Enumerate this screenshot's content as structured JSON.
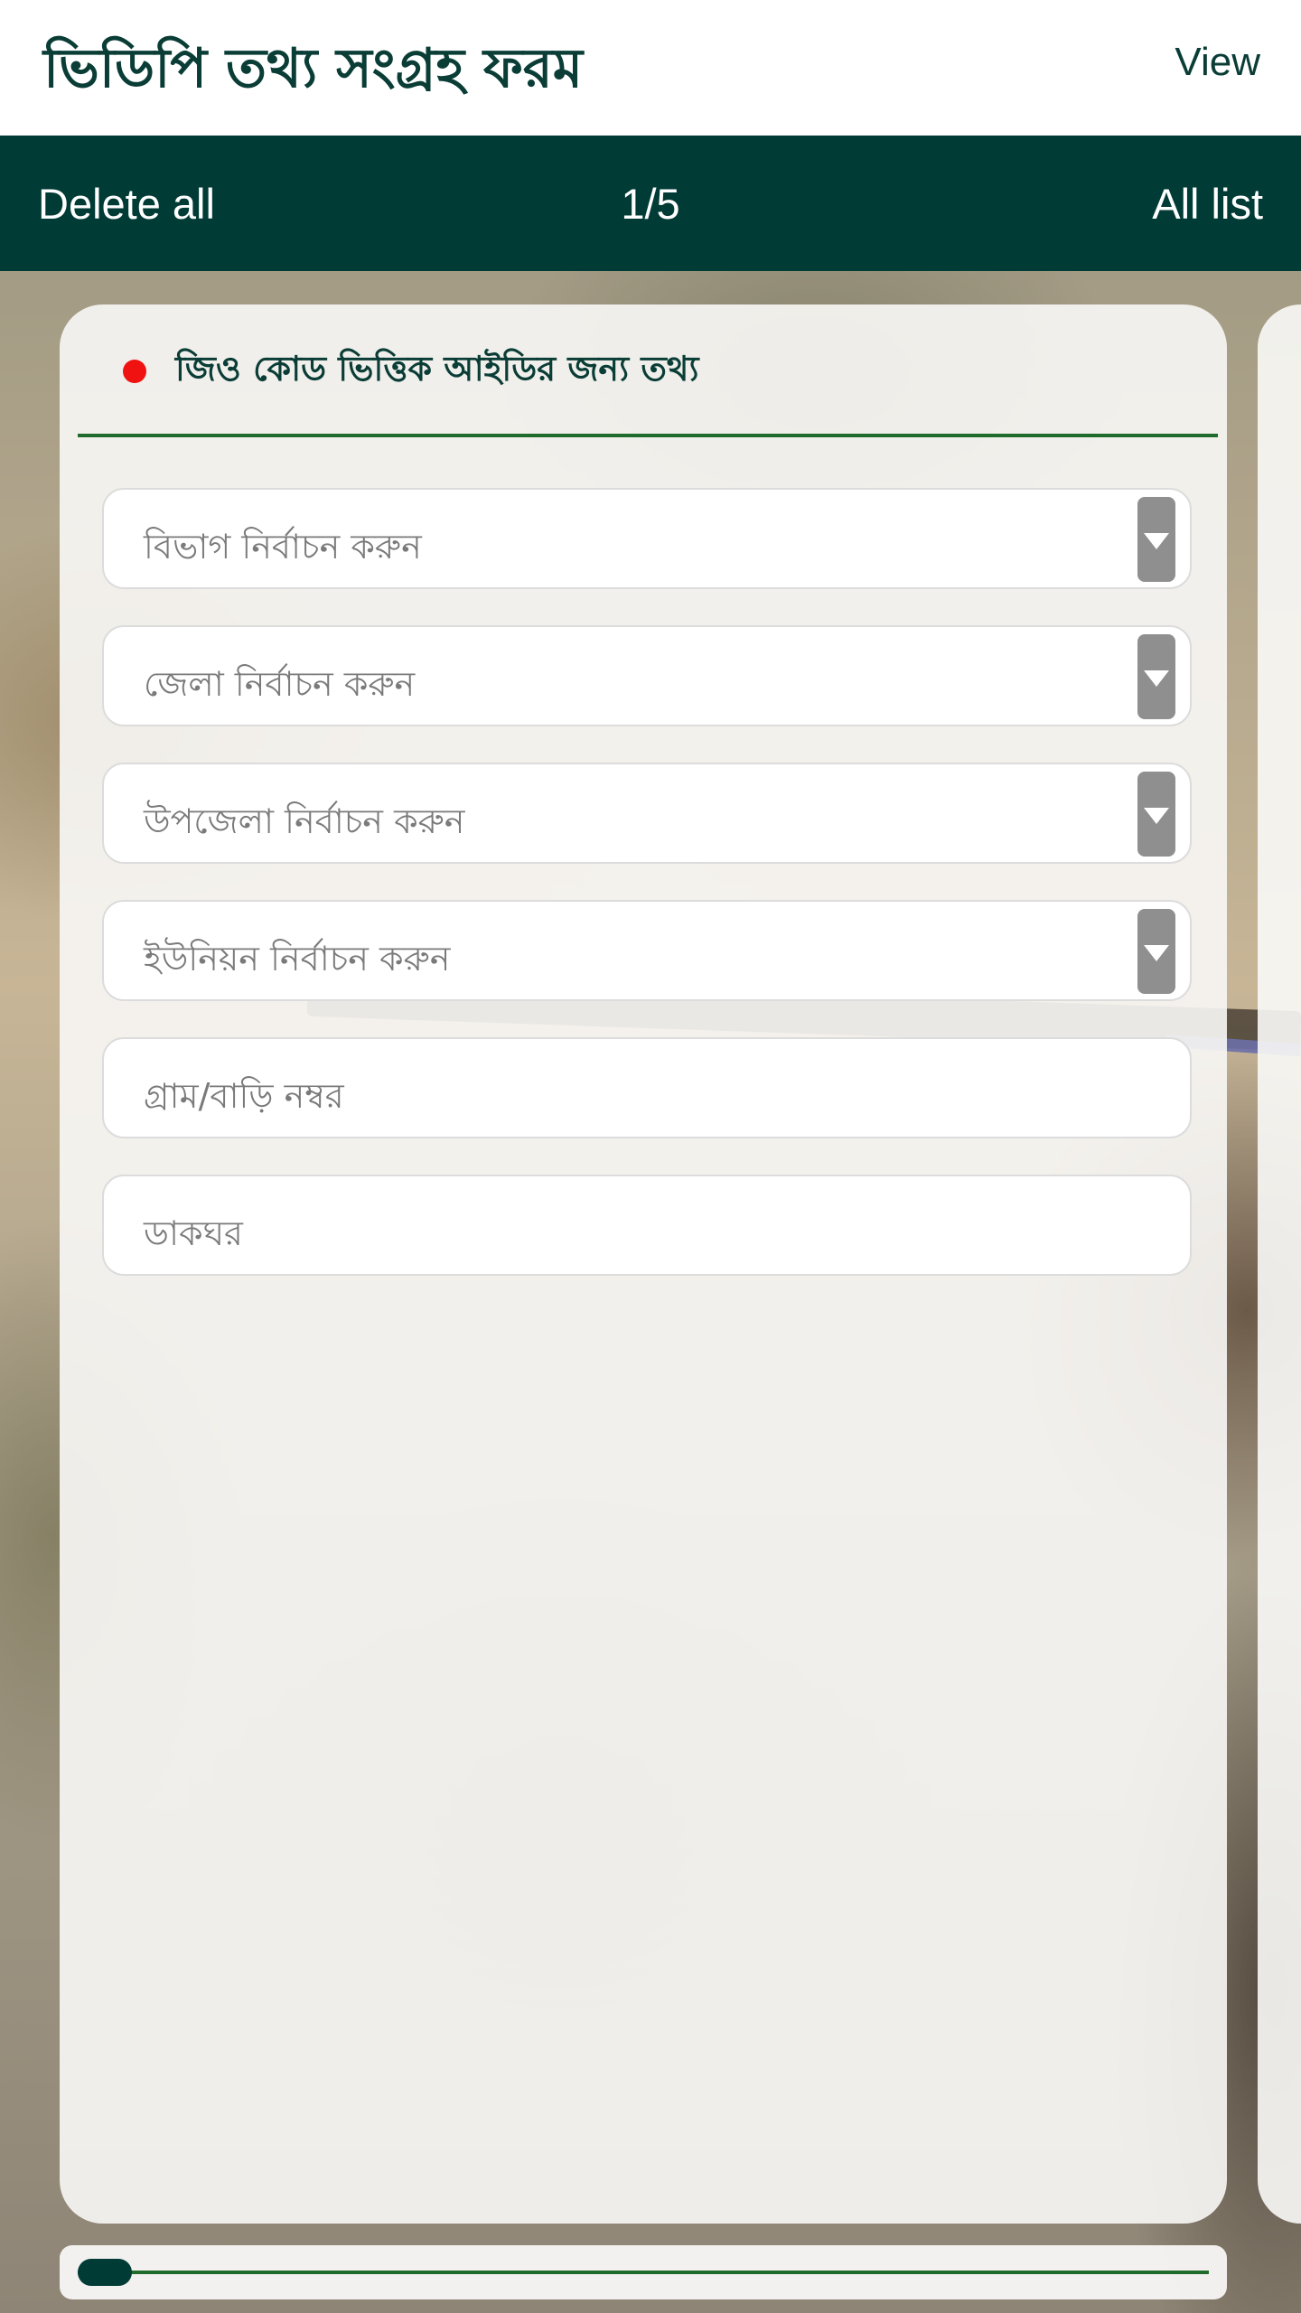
{
  "header": {
    "title": "ভিডিপি তথ্য সংগ্রহ ফরম",
    "view_label": "View"
  },
  "navbar": {
    "delete_all_label": "Delete all",
    "page_indicator": "1/5",
    "all_list_label": "All list"
  },
  "form": {
    "section_title": "জিও কোড ভিত্তিক আইডির জন্য তথ্য",
    "fields": [
      {
        "placeholder": "বিভাগ নির্বাচন করুন",
        "type": "select"
      },
      {
        "placeholder": "জেলা নির্বাচন করুন",
        "type": "select"
      },
      {
        "placeholder": "উপজেলা নির্বাচন করুন",
        "type": "select"
      },
      {
        "placeholder": "ইউনিয়ন নির্বাচন করুন",
        "type": "select"
      },
      {
        "placeholder": "গ্রাম/বাড়ি নম্বর",
        "type": "text"
      },
      {
        "placeholder": "ডাকঘর",
        "type": "text"
      }
    ]
  },
  "pager": {
    "current_page": 1,
    "total_pages": 5
  },
  "colors": {
    "primary": "#013b36",
    "accent_line": "#1f6b2c",
    "required_dot": "#f01111"
  }
}
